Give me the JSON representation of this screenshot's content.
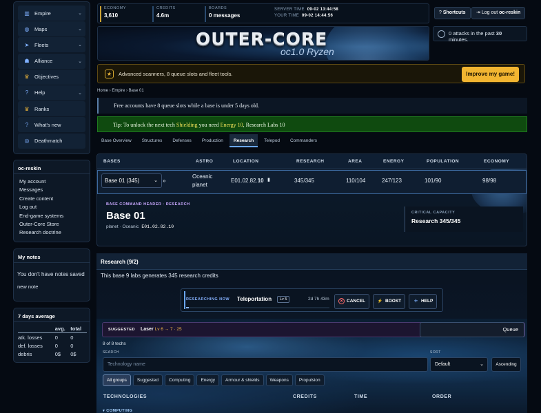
{
  "nav": [
    {
      "label": "Empire",
      "icon": "chart-icon",
      "chevron": true
    },
    {
      "label": "Maps",
      "icon": "globe-icon",
      "chevron": true
    },
    {
      "label": "Fleets",
      "icon": "rocket-icon",
      "chevron": true
    },
    {
      "label": "Alliance",
      "icon": "users-icon",
      "chevron": true
    },
    {
      "label": "Objectives",
      "icon": "trophy-icon",
      "chevron": false
    },
    {
      "label": "Help",
      "icon": "help-icon",
      "chevron": true
    },
    {
      "label": "Ranks",
      "icon": "trophy-icon",
      "chevron": false
    },
    {
      "label": "What's new",
      "icon": "help-icon",
      "chevron": false
    },
    {
      "label": "Deathmatch",
      "icon": "target-icon",
      "chevron": false
    }
  ],
  "user": {
    "name": "oc-reskin",
    "links": [
      "My account",
      "Messages",
      "Create content",
      "Log out",
      "End-game systems",
      "Outer-Core Store",
      "Research doctrine"
    ]
  },
  "notes": {
    "title": "My notes",
    "empty": "You don't have notes saved",
    "new_label": "new note"
  },
  "avg": {
    "title": "7 days average",
    "headers": [
      "",
      "avg.",
      "total"
    ],
    "rows": [
      [
        "atk. losses",
        "0",
        "0"
      ],
      [
        "def. losses",
        "0",
        "0"
      ],
      [
        "debris",
        "0$",
        "0$"
      ]
    ]
  },
  "stats": {
    "economy_label": "ECONOMY",
    "economy": "3,610",
    "credits_label": "CREDITS",
    "credits": "4.6m",
    "boards_label": "BOARDS",
    "boards": "0 messages",
    "server_time_label": "SERVER TIME",
    "server_time": "09-02 13:44:58",
    "your_time_label": "YOUR TIME",
    "your_time": "09-02 14:44:56"
  },
  "top": {
    "shortcuts": "Shortcuts",
    "logout": "Log out",
    "logout_user": "oc-reskin"
  },
  "attacks": {
    "pre": "0 attacks in the past ",
    "num": "30",
    "post": " minutes."
  },
  "banner": {
    "logo": "OUTER-CORE",
    "sub": "oc1.0 Ryzen"
  },
  "promo": {
    "text": "Advanced scanners, 8 queue slots and fleet tools.",
    "button": "Improve my game!"
  },
  "breadcrumb": "Home › Empire › Base 01",
  "notice1": "Free accounts have 8 queue slots while a base is under 5 days old.",
  "notice2": {
    "pre": "Tip: To unlock the next tech ",
    "tech": "Shielding",
    "mid": " you need ",
    "req": "Energy 10",
    "post": ", Research Labs 10"
  },
  "tabs": [
    "Base Overview",
    "Structures",
    "Defenses",
    "Production",
    "Research",
    "Telepod",
    "Commanders"
  ],
  "active_tab": "Research",
  "bases": {
    "headers": [
      "BASES",
      "ASTRO",
      "LOCATION",
      "RESEARCH",
      "AREA",
      "ENERGY",
      "POPULATION",
      "ECONOMY"
    ],
    "select": "Base 01 (345)",
    "next": "»",
    "astro": "Oceanic planet",
    "location_pre": "E01.02.82.",
    "location_bold": "10",
    "research": "345/345",
    "area": "110/104",
    "energy": "247/123",
    "population": "101/90",
    "economy": "98/98"
  },
  "base_header": {
    "kicker": "BASE COMMAND HEADER · RESEARCH",
    "name": "Base 01",
    "meta": "planet · Oceanic",
    "coord": "E01.02.82.10",
    "crit_label": "CRITICAL CAPACITY",
    "crit_value": "Research 345/345"
  },
  "research": {
    "title": "Research (9/2)",
    "desc": "This base 9 labs generates 345 research credits",
    "now_label": "RESEARCHING NOW",
    "now_name": "Teleportation",
    "now_level": "Lv 5",
    "now_time": "2d 7h 43m",
    "progress": 0.02,
    "cancel": "CANCEL",
    "boost": "BOOST",
    "help": "HELP",
    "suggested_label": "SUGGESTED",
    "suggested_name": "Laser",
    "suggested_meta": "Lv 6 → 7 · 25",
    "queue": "Queue",
    "count": "8 of 8 techs",
    "search_label": "SEARCH",
    "search_placeholder": "Technology name",
    "sort_label": "SORT",
    "sort_value": "Default",
    "asc": "Ascending",
    "chips": [
      "All groups",
      "Suggested",
      "Computing",
      "Energy",
      "Armour & shields",
      "Weapons",
      "Propulsion"
    ],
    "columns": [
      "TECHNOLOGIES",
      "CREDITS",
      "TIME",
      "ORDER"
    ],
    "group": "▾ COMPUTING"
  }
}
